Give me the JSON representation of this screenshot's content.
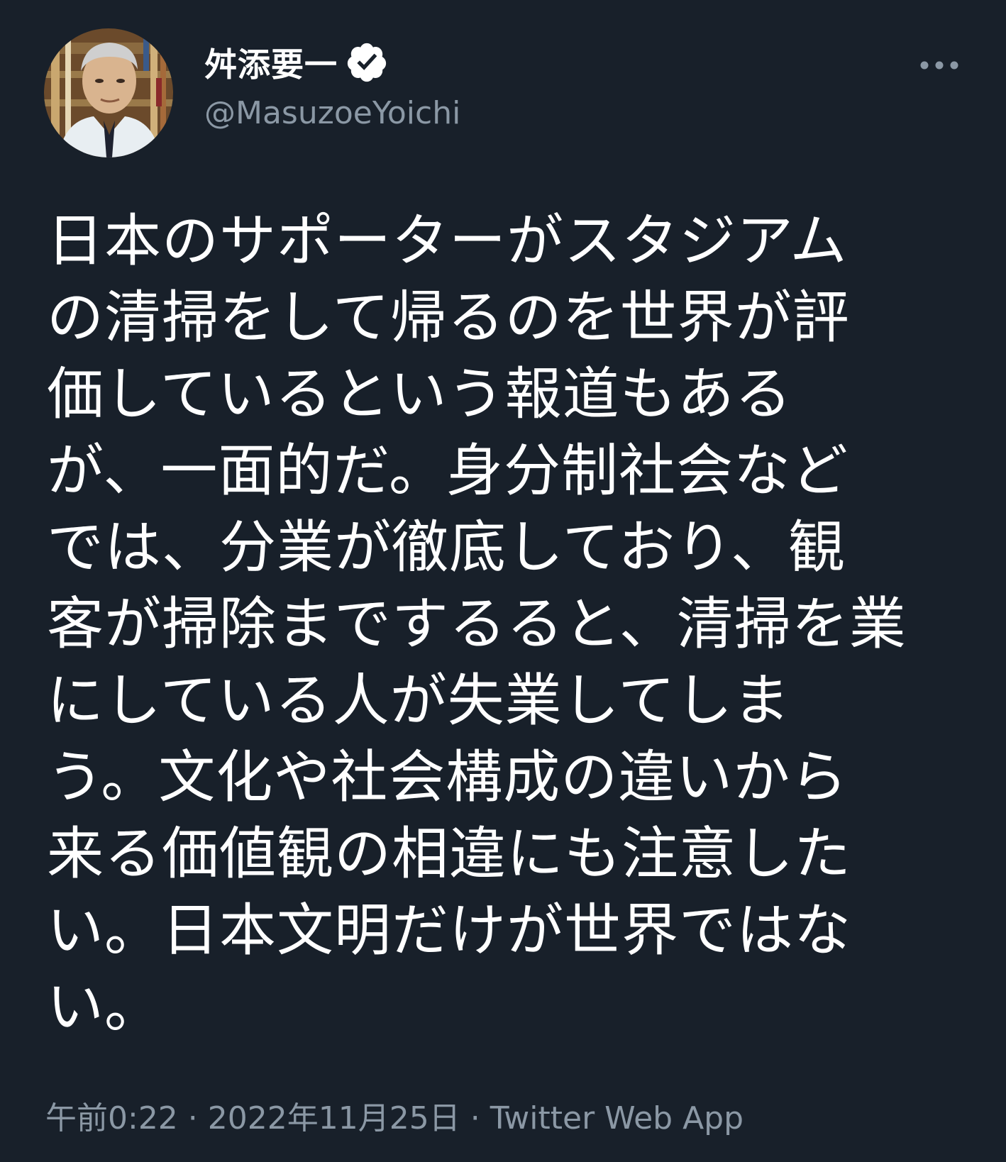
{
  "author": {
    "display_name": "舛添要一",
    "handle": "@MasuzoeYoichi",
    "verified": true
  },
  "icons": {
    "verified": "verified-badge-icon",
    "more": "more-options-icon"
  },
  "tweet": {
    "text": "日本のサポーターがスタジアム\nの清掃をして帰るのを世界が評\n価しているという報道もある\nが、一面的だ。身分制社会など\nでは、分業が徹底しており、観\n客が掃除までするると、清掃を業\nにしている人が失業してしま\nう。文化や社会構成の違いから\n来る価値観の相違にも注意した\nい。日本文明だけが世界ではな\nい。"
  },
  "meta": {
    "time": "午前0:22",
    "separator": " · ",
    "date": "2022年11月25日",
    "source": "Twitter Web App"
  },
  "colors": {
    "background": "#18202a",
    "text": "#ffffff",
    "secondary": "#8b98a5"
  }
}
